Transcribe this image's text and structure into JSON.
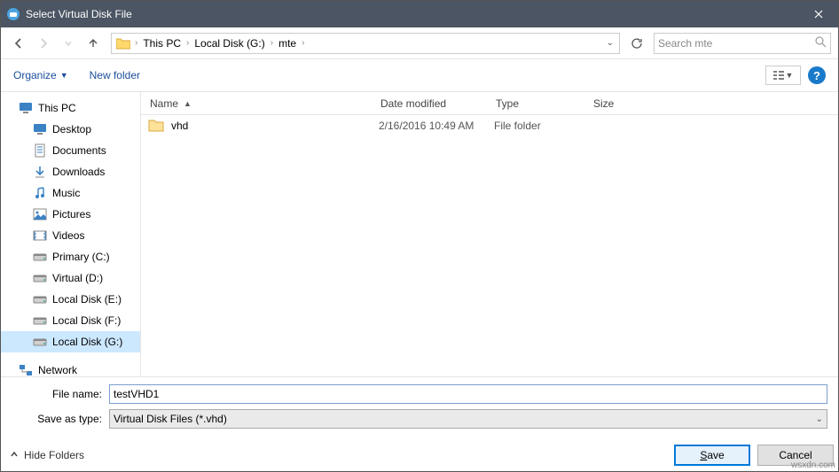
{
  "window": {
    "title": "Select Virtual Disk File"
  },
  "breadcrumb": {
    "parts": [
      "This PC",
      "Local Disk (G:)",
      "mte"
    ]
  },
  "search": {
    "placeholder": "Search mte"
  },
  "toolbar": {
    "organize": "Organize",
    "newfolder": "New folder"
  },
  "columns": {
    "name": "Name",
    "date": "Date modified",
    "type": "Type",
    "size": "Size"
  },
  "sidebar": {
    "root": "This PC",
    "items": [
      {
        "label": "Desktop",
        "kind": "desktop"
      },
      {
        "label": "Documents",
        "kind": "docs"
      },
      {
        "label": "Downloads",
        "kind": "down"
      },
      {
        "label": "Music",
        "kind": "music"
      },
      {
        "label": "Pictures",
        "kind": "pics"
      },
      {
        "label": "Videos",
        "kind": "video"
      },
      {
        "label": "Primary (C:)",
        "kind": "drive"
      },
      {
        "label": "Virtual (D:)",
        "kind": "drive"
      },
      {
        "label": "Local Disk (E:)",
        "kind": "drive"
      },
      {
        "label": "Local Disk (F:)",
        "kind": "drive"
      },
      {
        "label": "Local Disk (G:)",
        "kind": "drive",
        "selected": true
      }
    ],
    "network": "Network"
  },
  "files": [
    {
      "name": "vhd",
      "date": "2/16/2016 10:49 AM",
      "type": "File folder",
      "size": ""
    }
  ],
  "form": {
    "filename_label": "File name:",
    "filename_value": "testVHD1",
    "type_label": "Save as type:",
    "type_value": "Virtual Disk Files (*.vhd)"
  },
  "buttons": {
    "hidefolders": "Hide Folders",
    "save": "Save",
    "cancel": "Cancel"
  },
  "watermark": "wsxdn.com"
}
